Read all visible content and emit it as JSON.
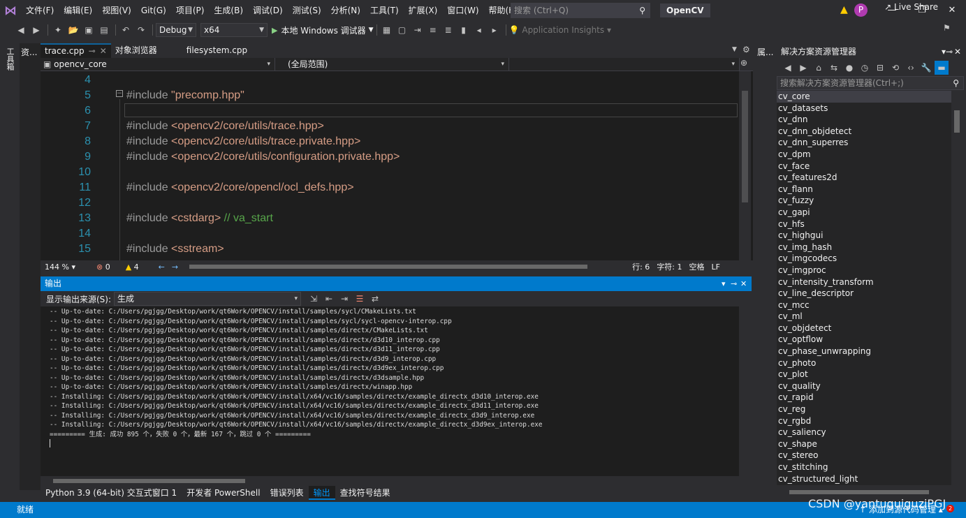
{
  "menubar": {
    "items": [
      "文件(F)",
      "编辑(E)",
      "视图(V)",
      "Git(G)",
      "项目(P)",
      "生成(B)",
      "调试(D)",
      "测试(S)",
      "分析(N)",
      "工具(T)",
      "扩展(X)",
      "窗口(W)",
      "帮助(H)"
    ],
    "search_placeholder": "搜索 (Ctrl+Q)",
    "solution_name": "OpenCV",
    "avatar_letter": "P"
  },
  "toolbar": {
    "config": "Debug",
    "platform": "x64",
    "run_label": "本地 Windows 调试器",
    "insights": "Application Insights",
    "live_share": "Live Share"
  },
  "side": {
    "toolbox": "工具箱",
    "resource_view": "资...",
    "properties": "属..."
  },
  "editor": {
    "tabs": [
      "trace.cpp",
      "对象浏览器",
      "filesystem.cpp"
    ],
    "project_scope": "opencv_core",
    "scope": "(全局范围)",
    "lines": [
      {
        "n": "4",
        "parts": []
      },
      {
        "n": "5",
        "parts": [
          {
            "t": "#include ",
            "c": "inc"
          },
          {
            "t": "\"precomp.hpp\"",
            "c": "str"
          }
        ]
      },
      {
        "n": "6",
        "parts": []
      },
      {
        "n": "7",
        "parts": [
          {
            "t": "#include ",
            "c": "inc"
          },
          {
            "t": "<opencv2/core/utils/trace.hpp>",
            "c": "str"
          }
        ]
      },
      {
        "n": "8",
        "parts": [
          {
            "t": "#include ",
            "c": "inc"
          },
          {
            "t": "<opencv2/core/utils/trace.private.hpp>",
            "c": "str"
          }
        ]
      },
      {
        "n": "9",
        "parts": [
          {
            "t": "#include ",
            "c": "inc"
          },
          {
            "t": "<opencv2/core/utils/configuration.private.hpp>",
            "c": "str"
          }
        ]
      },
      {
        "n": "10",
        "parts": []
      },
      {
        "n": "11",
        "parts": [
          {
            "t": "#include ",
            "c": "inc"
          },
          {
            "t": "<opencv2/core/opencl/ocl_defs.hpp>",
            "c": "str"
          }
        ]
      },
      {
        "n": "12",
        "parts": []
      },
      {
        "n": "13",
        "parts": [
          {
            "t": "#include ",
            "c": "inc"
          },
          {
            "t": "<cstdarg>",
            "c": "str"
          },
          {
            "t": " // va_start",
            "c": "cmt"
          }
        ]
      },
      {
        "n": "14",
        "parts": []
      },
      {
        "n": "15",
        "parts": [
          {
            "t": "#include ",
            "c": "inc"
          },
          {
            "t": "<sstream>",
            "c": "str"
          }
        ]
      }
    ],
    "status": {
      "zoom": "144 %",
      "errors": "0",
      "warnings": "4",
      "row": "行: 6",
      "col": "字符: 1",
      "ws": "空格",
      "eol": "LF"
    }
  },
  "output": {
    "title": "输出",
    "source_label": "显示输出来源(S):",
    "source_value": "生成",
    "lines": [
      "-- Up-to-date: C:/Users/pgjgg/Desktop/work/qt6Work/OPENCV/install/samples/sycl/CMakeLists.txt",
      "-- Up-to-date: C:/Users/pgjgg/Desktop/work/qt6Work/OPENCV/install/samples/sycl/sycl-opencv-interop.cpp",
      "-- Up-to-date: C:/Users/pgjgg/Desktop/work/qt6Work/OPENCV/install/samples/directx/CMakeLists.txt",
      "-- Up-to-date: C:/Users/pgjgg/Desktop/work/qt6Work/OPENCV/install/samples/directx/d3d10_interop.cpp",
      "-- Up-to-date: C:/Users/pgjgg/Desktop/work/qt6Work/OPENCV/install/samples/directx/d3d11_interop.cpp",
      "-- Up-to-date: C:/Users/pgjgg/Desktop/work/qt6Work/OPENCV/install/samples/directx/d3d9_interop.cpp",
      "-- Up-to-date: C:/Users/pgjgg/Desktop/work/qt6Work/OPENCV/install/samples/directx/d3d9ex_interop.cpp",
      "-- Up-to-date: C:/Users/pgjgg/Desktop/work/qt6Work/OPENCV/install/samples/directx/d3dsample.hpp",
      "-- Up-to-date: C:/Users/pgjgg/Desktop/work/qt6Work/OPENCV/install/samples/directx/winapp.hpp",
      "-- Installing: C:/Users/pgjgg/Desktop/work/qt6Work/OPENCV/install/x64/vc16/samples/directx/example_directx_d3d10_interop.exe",
      "-- Installing: C:/Users/pgjgg/Desktop/work/qt6Work/OPENCV/install/x64/vc16/samples/directx/example_directx_d3d11_interop.exe",
      "-- Installing: C:/Users/pgjgg/Desktop/work/qt6Work/OPENCV/install/x64/vc16/samples/directx/example_directx_d3d9_interop.exe",
      "-- Installing: C:/Users/pgjgg/Desktop/work/qt6Work/OPENCV/install/x64/vc16/samples/directx/example_directx_d3d9ex_interop.exe",
      "========= 生成: 成功 895 个，失败 0 个，最新 167 个，跳过 0 个 ========="
    ]
  },
  "bottom_tabs": [
    "Python 3.9 (64-bit) 交互式窗口 1",
    "开发者 PowerShell",
    "错误列表",
    "输出",
    "查找符号结果"
  ],
  "solution_explorer": {
    "title": "解决方案资源管理器",
    "search_placeholder": "搜索解决方案资源管理器(Ctrl+;)",
    "items": [
      "cv_core",
      "cv_datasets",
      "cv_dnn",
      "cv_dnn_objdetect",
      "cv_dnn_superres",
      "cv_dpm",
      "cv_face",
      "cv_features2d",
      "cv_flann",
      "cv_fuzzy",
      "cv_gapi",
      "cv_hfs",
      "cv_highgui",
      "cv_img_hash",
      "cv_imgcodecs",
      "cv_imgproc",
      "cv_intensity_transform",
      "cv_line_descriptor",
      "cv_mcc",
      "cv_ml",
      "cv_objdetect",
      "cv_optflow",
      "cv_phase_unwrapping",
      "cv_photo",
      "cv_plot",
      "cv_quality",
      "cv_rapid",
      "cv_reg",
      "cv_rgbd",
      "cv_saliency",
      "cv_shape",
      "cv_stereo",
      "cv_stitching",
      "cv_structured_light"
    ]
  },
  "statusbar": {
    "ready": "就绪",
    "source_control": "添加到源代码管理",
    "watermark": "CSDN @yantuguiguziPGJ",
    "notifications": "2"
  },
  "colors": {
    "accent": "#007acc",
    "keyword": "#9b9b9b",
    "string": "#d69d85",
    "comment": "#57a64a",
    "line_number": "#2b91af"
  }
}
